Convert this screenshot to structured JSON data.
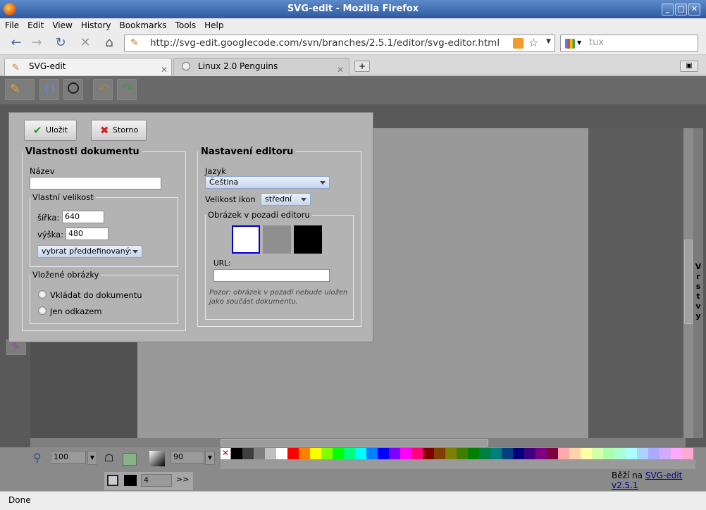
{
  "window": {
    "title": "SVG-edit - Mozilla Firefox",
    "controls": [
      "_",
      "□",
      "✕"
    ]
  },
  "menu": [
    "File",
    "Edit",
    "View",
    "History",
    "Bookmarks",
    "Tools",
    "Help"
  ],
  "nav": {
    "url": "http://svg-edit.googlecode.com/svn/branches/2.5.1/editor/svg-editor.html",
    "search_placeholder": "tux"
  },
  "tabs": [
    {
      "label": "SVG-edit",
      "active": true
    },
    {
      "label": "Linux 2.0 Penguins",
      "active": false
    }
  ],
  "dialog": {
    "save_label": "Uložit",
    "cancel_label": "Storno",
    "doc_props": {
      "legend": "Vlastnosti dokumentu",
      "name_label": "Název",
      "name_value": "",
      "custom_size_legend": "Vlastní velikost",
      "width_label": "šířka:",
      "width_value": "640",
      "height_label": "výška:",
      "height_value": "480",
      "predefined_label": "vybrat předdefinovaný:",
      "embedded_legend": "Vložené obrázky",
      "embed_option": "Vkládat do dokumentu",
      "link_option": "Jen odkazem"
    },
    "editor_prefs": {
      "legend": "Nastavení editoru",
      "language_label": "Jazyk",
      "language_value": "Čeština",
      "icon_size_label": "Velikost ikon",
      "icon_size_value": "střední",
      "bg_legend": "Obrázek v pozadí editoru",
      "bg_colors": [
        "#ffffff",
        "#8f8f8f",
        "#000000"
      ],
      "url_label": "URL:",
      "url_value": "",
      "note": "Pozor: obrázek v pozadí nebude uložen jako součást dokumentu."
    }
  },
  "editor": {
    "layers_label": "Vrstvy",
    "zoom_value": "100",
    "opacity_value": "90",
    "stroke_width_value": "4",
    "more_label": ">>",
    "credit_prefix": "Běží na",
    "credit_link": "SVG-edit v2.5.1",
    "palette": [
      "#000000",
      "#3f3f3f",
      "#7f7f7f",
      "#bfbfbf",
      "#ffffff",
      "#ff0000",
      "#ff7f00",
      "#ffff00",
      "#7fff00",
      "#00ff00",
      "#00ff7f",
      "#00ffff",
      "#007fff",
      "#0000ff",
      "#7f00ff",
      "#ff00ff",
      "#ff007f",
      "#7f0000",
      "#7f3f00",
      "#7f7f00",
      "#3f7f00",
      "#007f00",
      "#007f3f",
      "#007f7f",
      "#003f7f",
      "#00007f",
      "#3f007f",
      "#7f007f",
      "#7f003f",
      "#ffaaaa",
      "#ffd4aa",
      "#ffffaa",
      "#d4ffaa",
      "#aaffaa",
      "#aaffd4",
      "#aaffff",
      "#aad4ff",
      "#aaaaff",
      "#d4aaff",
      "#ffaaff",
      "#ffaad4"
    ]
  },
  "status": "Done"
}
